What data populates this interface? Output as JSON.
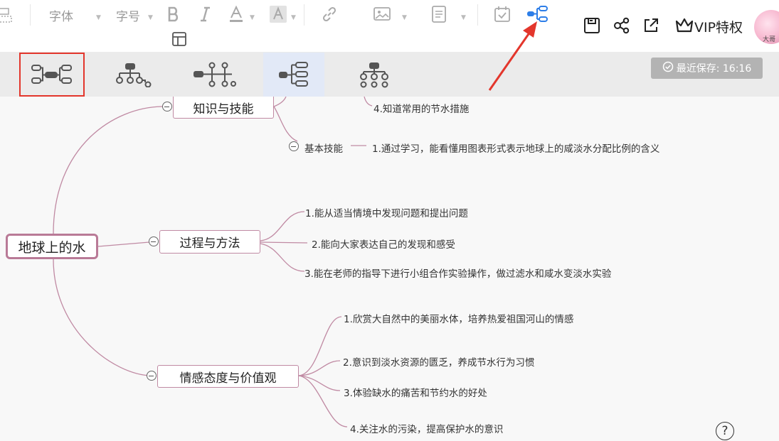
{
  "toolbar": {
    "font_label": "字体",
    "size_label": "字号",
    "vip_label": "VIP特权"
  },
  "layouts": [
    {
      "name": "logic-both-sides-layout"
    },
    {
      "name": "org-chart-layout"
    },
    {
      "name": "timeline-layout"
    },
    {
      "name": "logic-right-layout"
    },
    {
      "name": "tree-down-layout"
    }
  ],
  "status": {
    "saved_text": "最近保存: 16:16"
  },
  "mindmap": {
    "root": "地球上的水",
    "branches": [
      {
        "title": "知识与技能",
        "partial_leaf": "4.知道常用的节水措施",
        "sub": {
          "title": "基本技能",
          "leaf": "1.通过学习，能看懂用图表形式表示地球上的咸淡水分配比例的含义"
        }
      },
      {
        "title": "过程与方法",
        "leaves": [
          "1.能从适当情境中发现问题和提出问题",
          "2.能向大家表达自己的发现和感受",
          "3.能在老师的指导下进行小组合作实验操作，做过滤水和咸水变淡水实验"
        ]
      },
      {
        "title": "情感态度与价值观",
        "leaves": [
          "1.欣赏大自然中的美丽水体，培养热爱祖国河山的情感",
          "2.意识到淡水资源的匮乏，养成节水行为习惯",
          "3.体验缺水的痛苦和节约水的好处",
          "4.关注水的污染，提高保护水的意识"
        ]
      }
    ]
  },
  "help_label": "?",
  "colors": {
    "connector": "#c08aa3",
    "annotation_arrow": "#e3362c",
    "active_icon": "#2d7ee8",
    "selected_highlight": "#e3362c"
  }
}
